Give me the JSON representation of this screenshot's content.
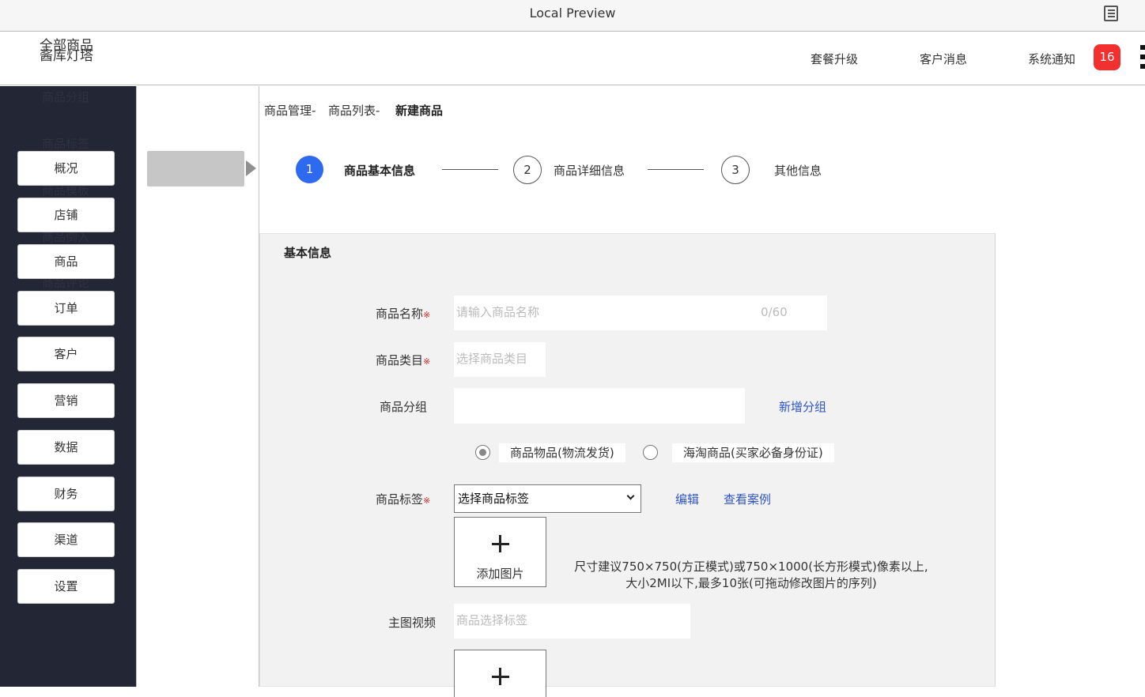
{
  "window": {
    "title": "Local Preview",
    "icon": "document-icon"
  },
  "header": {
    "brand_front": "酱库灯塔",
    "brand_back": "全部商品",
    "links": [
      "套餐升级",
      "客户消息",
      "系统通知"
    ],
    "notification_count": "16",
    "menu_icon": "kebab-menu-icon",
    "badge_color": "#f23030"
  },
  "sidebar": {
    "ghost_items": [
      "商品分组",
      "商品标签",
      "商品模板",
      "商品倒入",
      "商品评论"
    ],
    "items": [
      "概况",
      "店铺",
      "商品",
      "订单",
      "客户",
      "营销",
      "数据",
      "财务",
      "渠道",
      "设置"
    ],
    "bg_color": "#232634"
  },
  "breadcrumb": {
    "items": [
      "商品管理-",
      "商品列表-"
    ],
    "current": "新建商品"
  },
  "steps": [
    {
      "num": "1",
      "label": "商品基本信息",
      "active": true
    },
    {
      "num": "2",
      "label": "商品详细信息",
      "active": false
    },
    {
      "num": "3",
      "label": "其他信息",
      "active": false
    }
  ],
  "accent_color": "#2e6af0",
  "form": {
    "section_title": "基本信息",
    "name": {
      "label": "商品名称",
      "required_mark": "※",
      "placeholder": "请输入商品名称",
      "counter": "0/60"
    },
    "category": {
      "label": "商品类目",
      "required_mark": "※",
      "placeholder": "选择商品类目"
    },
    "group": {
      "label": "商品分组",
      "value": "",
      "add_link": "新增分组"
    },
    "type_options": [
      {
        "label": "商品物品(物流发货)",
        "checked": true
      },
      {
        "label": "海淘商品(买家必备身份证)",
        "checked": false
      }
    ],
    "tags": {
      "label": "商品标签",
      "required_mark": "※",
      "selected": "选择商品标签",
      "edit_link": "编辑",
      "example_link": "查看案例"
    },
    "image_upload": {
      "label": "添加图片",
      "hint_line1": "尺寸建议750×750(方正模式)或750×1000(长方形模式)像素以上,",
      "hint_line2": "大小2MI以下,最多10张(可拖动修改图片的序列)"
    },
    "video": {
      "label": "主图视频",
      "placeholder": "商品选择标签"
    }
  }
}
